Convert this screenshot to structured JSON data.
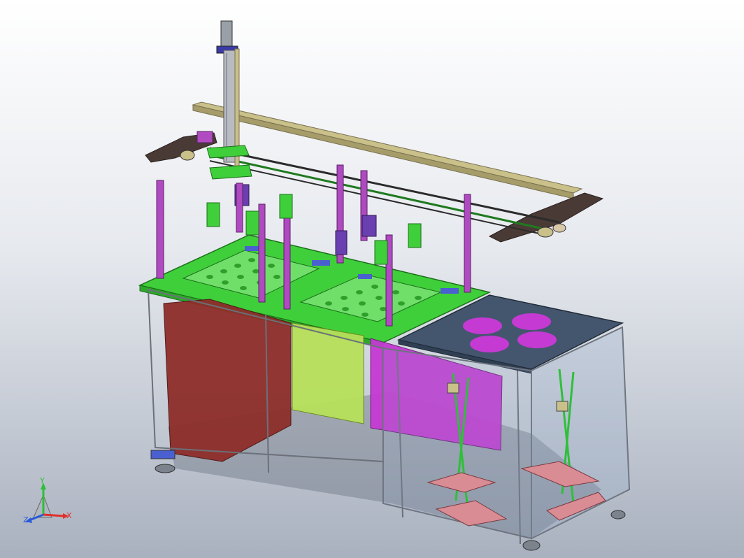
{
  "viewport": {
    "background_top": "#ffffff",
    "background_bottom": "#a9b1bf"
  },
  "model": {
    "colors": {
      "frame": "#6b7079",
      "green_plate": "#3fcf3a",
      "column": "#b04ac0",
      "dark_brown": "#4a3a36",
      "tan_rail": "#c9c08a",
      "red_panel": "#8e2e2a",
      "lime_panel": "#b7e05a",
      "magenta_panel": "#c43ad3",
      "navy_plate": "#44566e",
      "pink_foot": "#d98c93",
      "purple_block": "#6a3fb0"
    }
  },
  "triad": {
    "x_label": "X",
    "y_label": "Y",
    "z_label": "Z",
    "x_color": "#e0302a",
    "y_color": "#2fbf3a",
    "z_color": "#2a5ad8"
  }
}
